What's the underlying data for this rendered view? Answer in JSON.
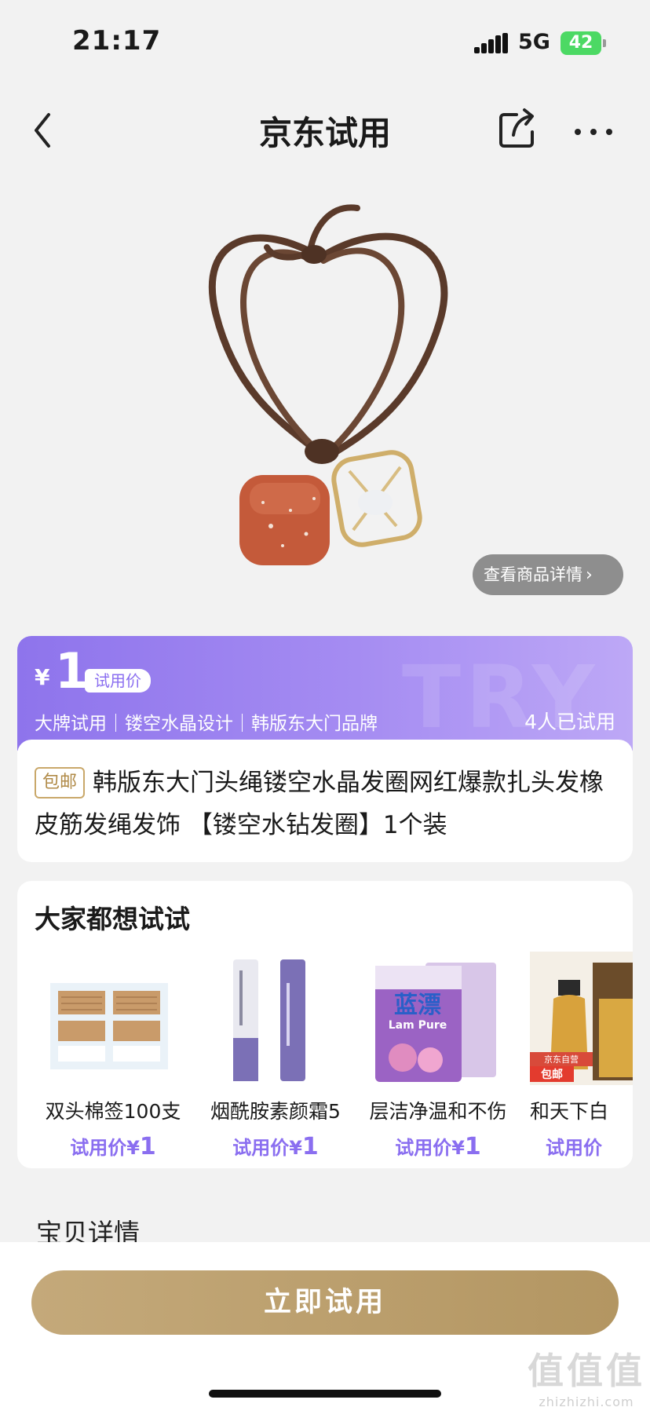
{
  "status_bar": {
    "time": "21:17",
    "network": "5G",
    "battery": "42"
  },
  "nav": {
    "title": "京东试用"
  },
  "product": {
    "detail_link": "查看商品详情",
    "price_currency": "¥",
    "price_value": "1",
    "price_tag": "试用价",
    "watermark_text": "TRY",
    "highlights": "大牌试用｜镂空水晶设计｜韩版东大门品牌",
    "tried_count": "4人已试用",
    "shipping_badge": "包邮",
    "title": "韩版东大门头绳镂空水晶发圈网红爆款扎头发橡皮筋发绳发饰 【镂空水钻发圈】1个装"
  },
  "recommendations": {
    "title": "大家都想试试",
    "items": [
      {
        "name": "双头棉签100支",
        "price_label": "试用价¥",
        "price_value": "1"
      },
      {
        "name": "烟酰胺素颜霜5",
        "price_label": "试用价¥",
        "price_value": "1"
      },
      {
        "name": "层洁净温和不伤",
        "price_label": "试用价¥",
        "price_value": "1",
        "brand": "蓝漂",
        "brand_en": "Lam Pure"
      },
      {
        "name": "和天下白",
        "price_label": "试用价",
        "price_value": "",
        "badge_top": "京东自营",
        "badge": "包邮"
      }
    ]
  },
  "details_section": {
    "title": "宝贝详情"
  },
  "cta": {
    "label": "立即试用"
  },
  "site_watermark": {
    "logo": "值值值",
    "url": "zhizhizhi.com"
  },
  "colors": {
    "accent_purple": "#8a6ef0",
    "gold": "#b39662",
    "battery_green": "#4cd964"
  }
}
